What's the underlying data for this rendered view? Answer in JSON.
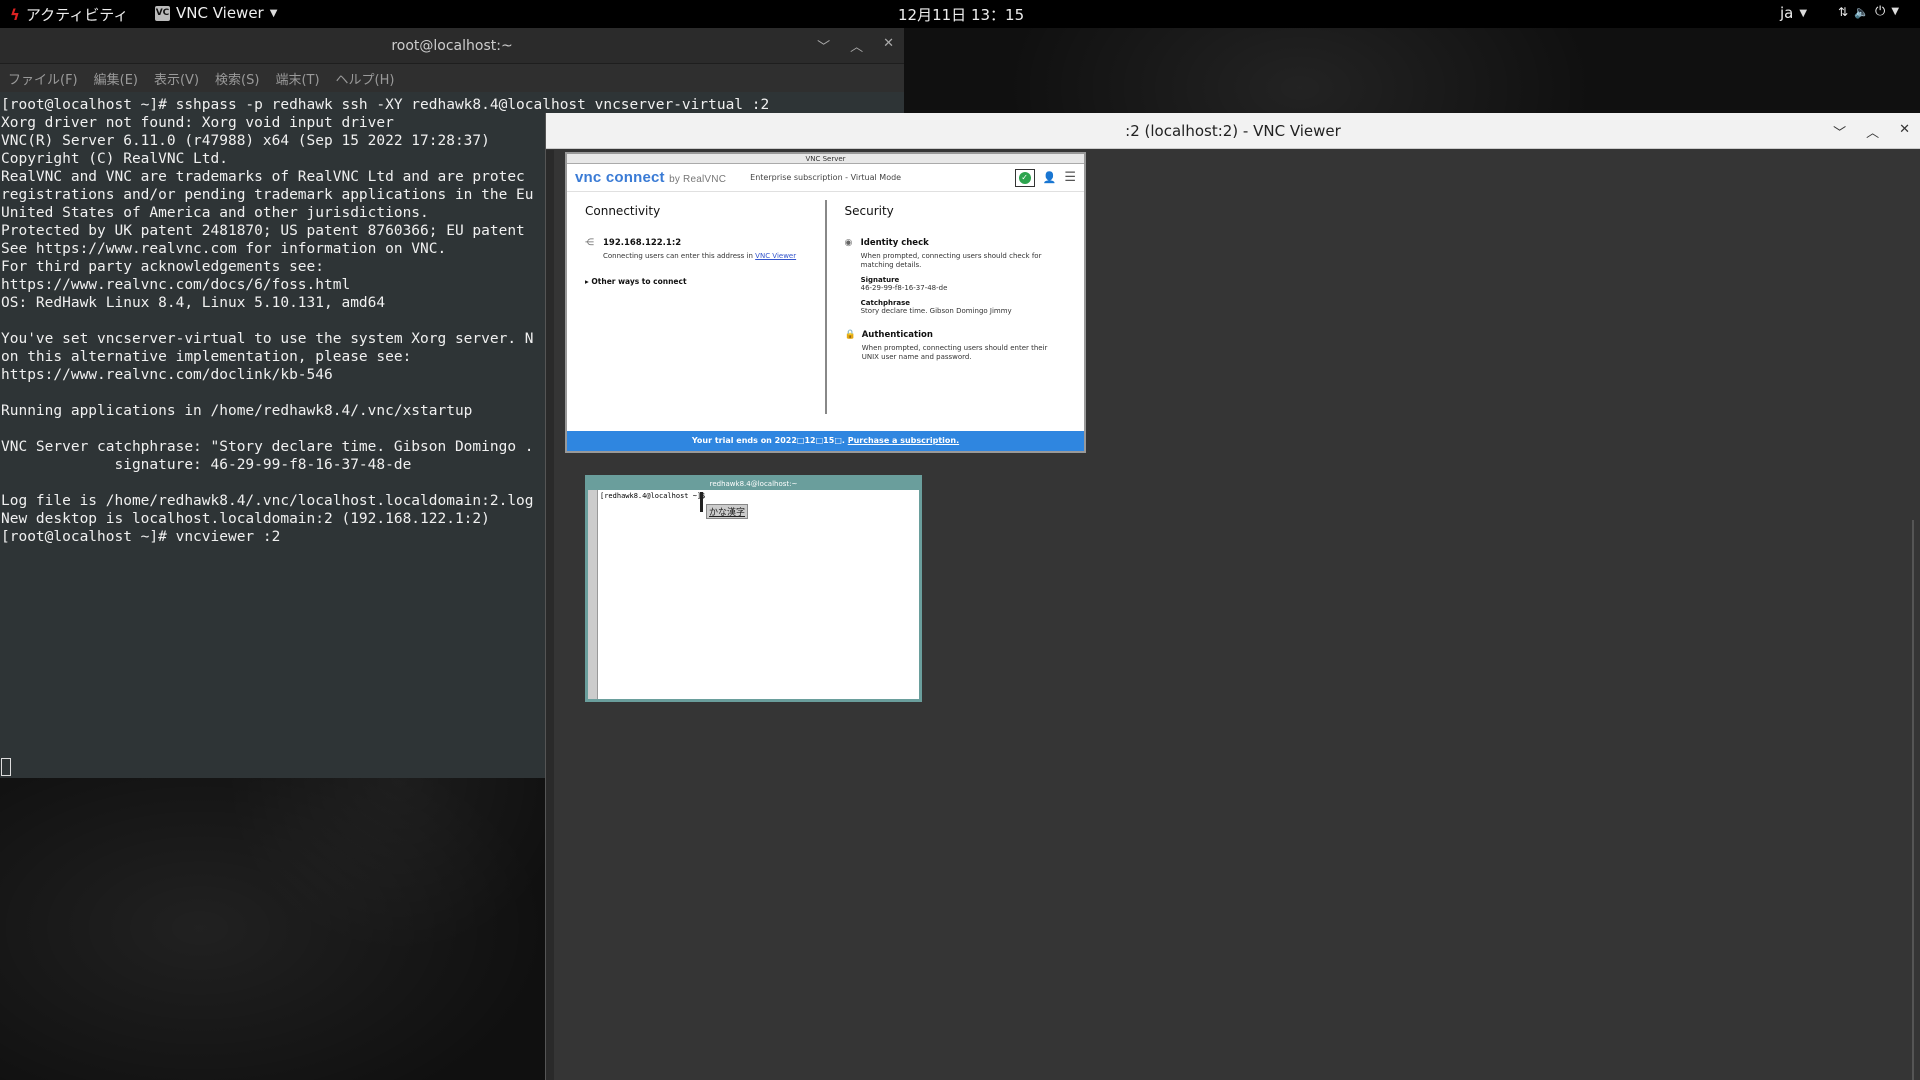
{
  "topbar": {
    "activities": "アクティビティ",
    "app_name": "VNC Viewer",
    "app_badge": "VC",
    "clock": "12月11日  13：15",
    "language": "ja"
  },
  "terminal": {
    "title": "root@localhost:~",
    "menus": [
      "ファイル(F)",
      "編集(E)",
      "表示(V)",
      "検索(S)",
      "端末(T)",
      "ヘルプ(H)"
    ],
    "lines": [
      "[root@localhost ~]# sshpass -p redhawk ssh -XY redhawk8.4@localhost vncserver-virtual :2",
      "Xorg driver not found: Xorg void input driver",
      "VNC(R) Server 6.11.0 (r47988) x64 (Sep 15 2022 17:28:37)",
      "Copyright (C) RealVNC Ltd.",
      "RealVNC and VNC are trademarks of RealVNC Ltd and are protec",
      "registrations and/or pending trademark applications in the Eu",
      "United States of America and other jurisdictions.",
      "Protected by UK patent 2481870; US patent 8760366; EU patent",
      "See https://www.realvnc.com for information on VNC.",
      "For third party acknowledgements see:",
      "https://www.realvnc.com/docs/6/foss.html",
      "OS: RedHawk Linux 8.4, Linux 5.10.131, amd64",
      "",
      "You've set vncserver-virtual to use the system Xorg server. N",
      "on this alternative implementation, please see:",
      "https://www.realvnc.com/doclink/kb-546",
      "",
      "Running applications in /home/redhawk8.4/.vnc/xstartup",
      "",
      "VNC Server catchphrase: \"Story declare time. Gibson Domingo .",
      "             signature: 46-29-99-f8-16-37-48-de",
      "",
      "Log file is /home/redhawk8.4/.vnc/localhost.localdomain:2.log",
      "New desktop is localhost.localdomain:2 (192.168.122.1:2)",
      "[root@localhost ~]# vncviewer :2"
    ]
  },
  "vnc_viewer": {
    "title": ":2 (localhost:2) - VNC Viewer"
  },
  "vnc_server": {
    "window_title": "VNC Server",
    "logo_main": "vnc connect",
    "logo_by": "by RealVNC",
    "subscription": "Enterprise subscription - Virtual Mode",
    "connectivity_heading": "Connectivity",
    "address": "192.168.122.1:2",
    "address_desc": "Connecting users can enter this address in",
    "address_link": "VNC Viewer",
    "other_ways": "Other ways to connect",
    "security_heading": "Security",
    "identity_title": "Identity check",
    "identity_desc": "When prompted, connecting users should check for matching details.",
    "signature_label": "Signature",
    "signature_value": "46-29-99-f8-16-37-48-de",
    "catchphrase_label": "Catchphrase",
    "catchphrase_value": "Story declare time. Gibson Domingo Jimmy",
    "auth_title": "Authentication",
    "auth_desc": "When prompted, connecting users should enter their UNIX user name and password.",
    "trial_text": "Your trial ends on 2022□12□15□.",
    "trial_link": "Purchase a subscription."
  },
  "xterm": {
    "title": "redhawk8.4@localhost:~",
    "prompt": "[redhawk8.4@localhost ~]$",
    "ime": "かな漢字"
  }
}
